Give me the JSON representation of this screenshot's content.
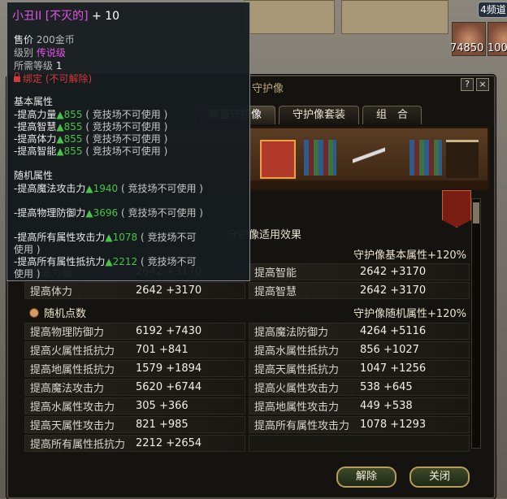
{
  "hud": {
    "top_right_button": "4频道",
    "slot_counts": [
      "74850",
      "100"
    ]
  },
  "tooltip": {
    "item_name": "小丑II [不灭的]",
    "enhance": "+ 10",
    "price_label": "售价",
    "price_value": "200金币",
    "grade_label": "级别",
    "grade_value": "传说级",
    "level_label": "所需等级",
    "level_value": "1",
    "bind_text": "绑定 (不可解除)",
    "base_header": "基本属性",
    "base_attrs": [
      {
        "name": "-提高力量",
        "value": "▲855",
        "note": "( 竞技场不可使用 )"
      },
      {
        "name": "-提高智慧",
        "value": "▲855",
        "note": "( 竞技场不可使用 )"
      },
      {
        "name": "-提高体力",
        "value": "▲855",
        "note": "( 竞技场不可使用 )"
      },
      {
        "name": "-提高智能",
        "value": "▲855",
        "note": "( 竞技场不可使用 )"
      }
    ],
    "random_header": "随机属性",
    "random_attrs": [
      {
        "name": "-提高魔法攻击力",
        "value": "▲1940",
        "note": "( 竞技场不可使用 )",
        "note2": ""
      },
      {
        "name": "-提高物理防御力",
        "value": "▲3696",
        "note": "( 竞技场不可使用 )",
        "note2": ""
      },
      {
        "name": "-提高所有属性攻击力",
        "value": "▲1078",
        "note": "( 竞技场不可",
        "note2": "使用 )"
      },
      {
        "name": "-提高所有属性抵抗力",
        "value": "▲2212",
        "note": "( 竞技场不可",
        "note2": "使用 )"
      }
    ]
  },
  "window": {
    "title": "守护像",
    "help_icon": "?",
    "close_icon": "×",
    "tabs": [
      "装备守护像",
      "守护像套装",
      "组　合"
    ],
    "effect_label": "守护像适用效果",
    "base_bonus": "守护像基本属性+120%",
    "base_rows": [
      {
        "name": "提高力量",
        "value": "2642 +3170"
      },
      {
        "name": "提高智能",
        "value": "2642 +3170"
      },
      {
        "name": "提高体力",
        "value": "2642 +3170"
      },
      {
        "name": "提高智慧",
        "value": "2642 +3170"
      }
    ],
    "random_title": "随机点数",
    "random_bonus": "守护像随机属性+120%",
    "random_rows": [
      {
        "name": "提高物理防御力",
        "value": "6192 +7430"
      },
      {
        "name": "提高魔法防御力",
        "value": "4264 +5116"
      },
      {
        "name": "提高火属性抵抗力",
        "value": "701 +841"
      },
      {
        "name": "提高水属性抵抗力",
        "value": "856 +1027"
      },
      {
        "name": "提高地属性抵抗力",
        "value": "1579 +1894"
      },
      {
        "name": "提高天属性抵抗力",
        "value": "1047 +1256"
      },
      {
        "name": "提高魔法攻击力",
        "value": "5620 +6744"
      },
      {
        "name": "提高火属性攻击力",
        "value": "538 +645"
      },
      {
        "name": "提高水属性攻击力",
        "value": "305 +366"
      },
      {
        "name": "提高地属性攻击力",
        "value": "449 +538"
      },
      {
        "name": "提高天属性攻击力",
        "value": "821 +985"
      },
      {
        "name": "提高所有属性攻击力",
        "value": "1078 +1293"
      },
      {
        "name": "提高所有属性抵抗力",
        "value": "2212 +2654"
      },
      {
        "name": "",
        "value": ""
      }
    ],
    "release_button": "解除",
    "close_button": "关闭"
  }
}
